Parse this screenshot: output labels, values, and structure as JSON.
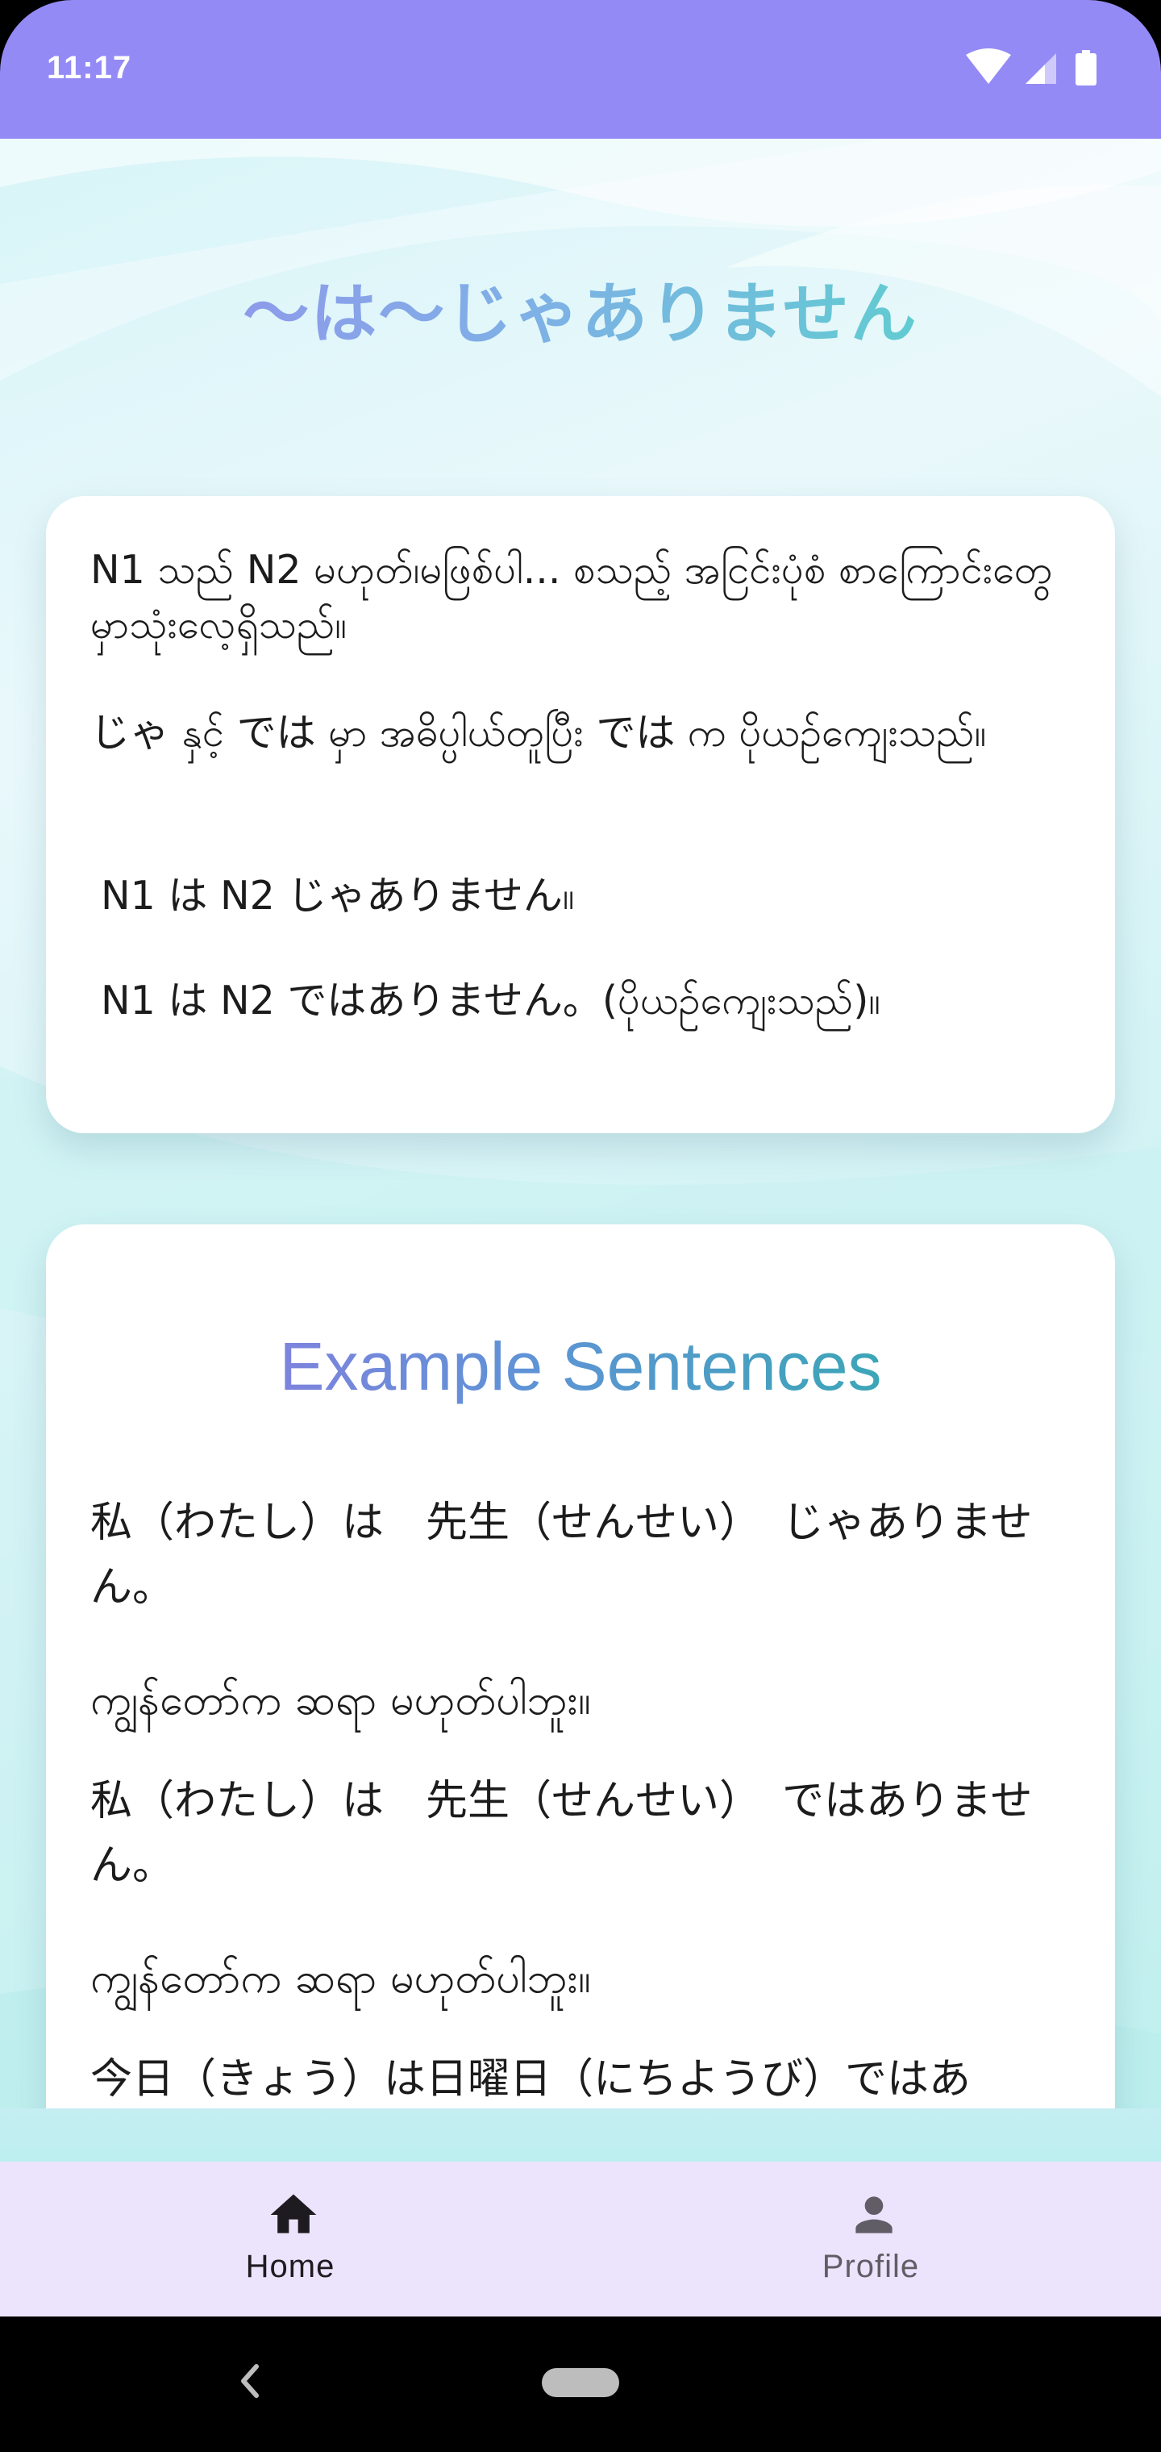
{
  "status_bar": {
    "time": "11:17",
    "icons": [
      "wifi-icon",
      "signal-icon",
      "battery-icon"
    ],
    "background": "#948af5"
  },
  "page": {
    "title": "〜は〜じゃありません"
  },
  "grammar_card": {
    "lines": [
      "N1 သည် N2 မဟုတ်၊မဖြစ်ပါ... စသည့် အငြင်းပုံစံ စာကြောင်းတွေမှာသုံးလေ့ရှိသည်။",
      " じゃ နှင့် では မှာ အဓိပ္ပါယ်တူပြီး では က ပိုယဉ်ကျေးသည်။",
      "N1  は  N2 じゃありません။",
      "N1  は  N2 ではありません。(ပိုယဉ်ကျေးသည်)။"
    ]
  },
  "examples_card": {
    "title": "Example Sentences",
    "sentences": [
      "私（わたし）は　先生（せんせい）　じゃありません。",
      "ကျွန်တော်က ဆရာ မဟုတ်ပါဘူး။",
      "私（わたし）は　先生（せんせい）　ではありません。",
      "ကျွန်တော်က ဆရာ မဟုတ်ပါဘူး။",
      "今日（きょう）は日曜日（にちようび）ではあ"
    ]
  },
  "bottom_nav": {
    "items": [
      {
        "label": "Home",
        "icon": "home-icon",
        "selected": true
      },
      {
        "label": "Profile",
        "icon": "person-icon",
        "selected": false
      }
    ]
  },
  "system_nav": {
    "icons": [
      "back-icon",
      "home-pill"
    ]
  },
  "colors": {
    "accent": "#948af5",
    "nav_background": "#ece4fc",
    "title_gradient": [
      "#9a88ee",
      "#4fdcc4"
    ]
  }
}
